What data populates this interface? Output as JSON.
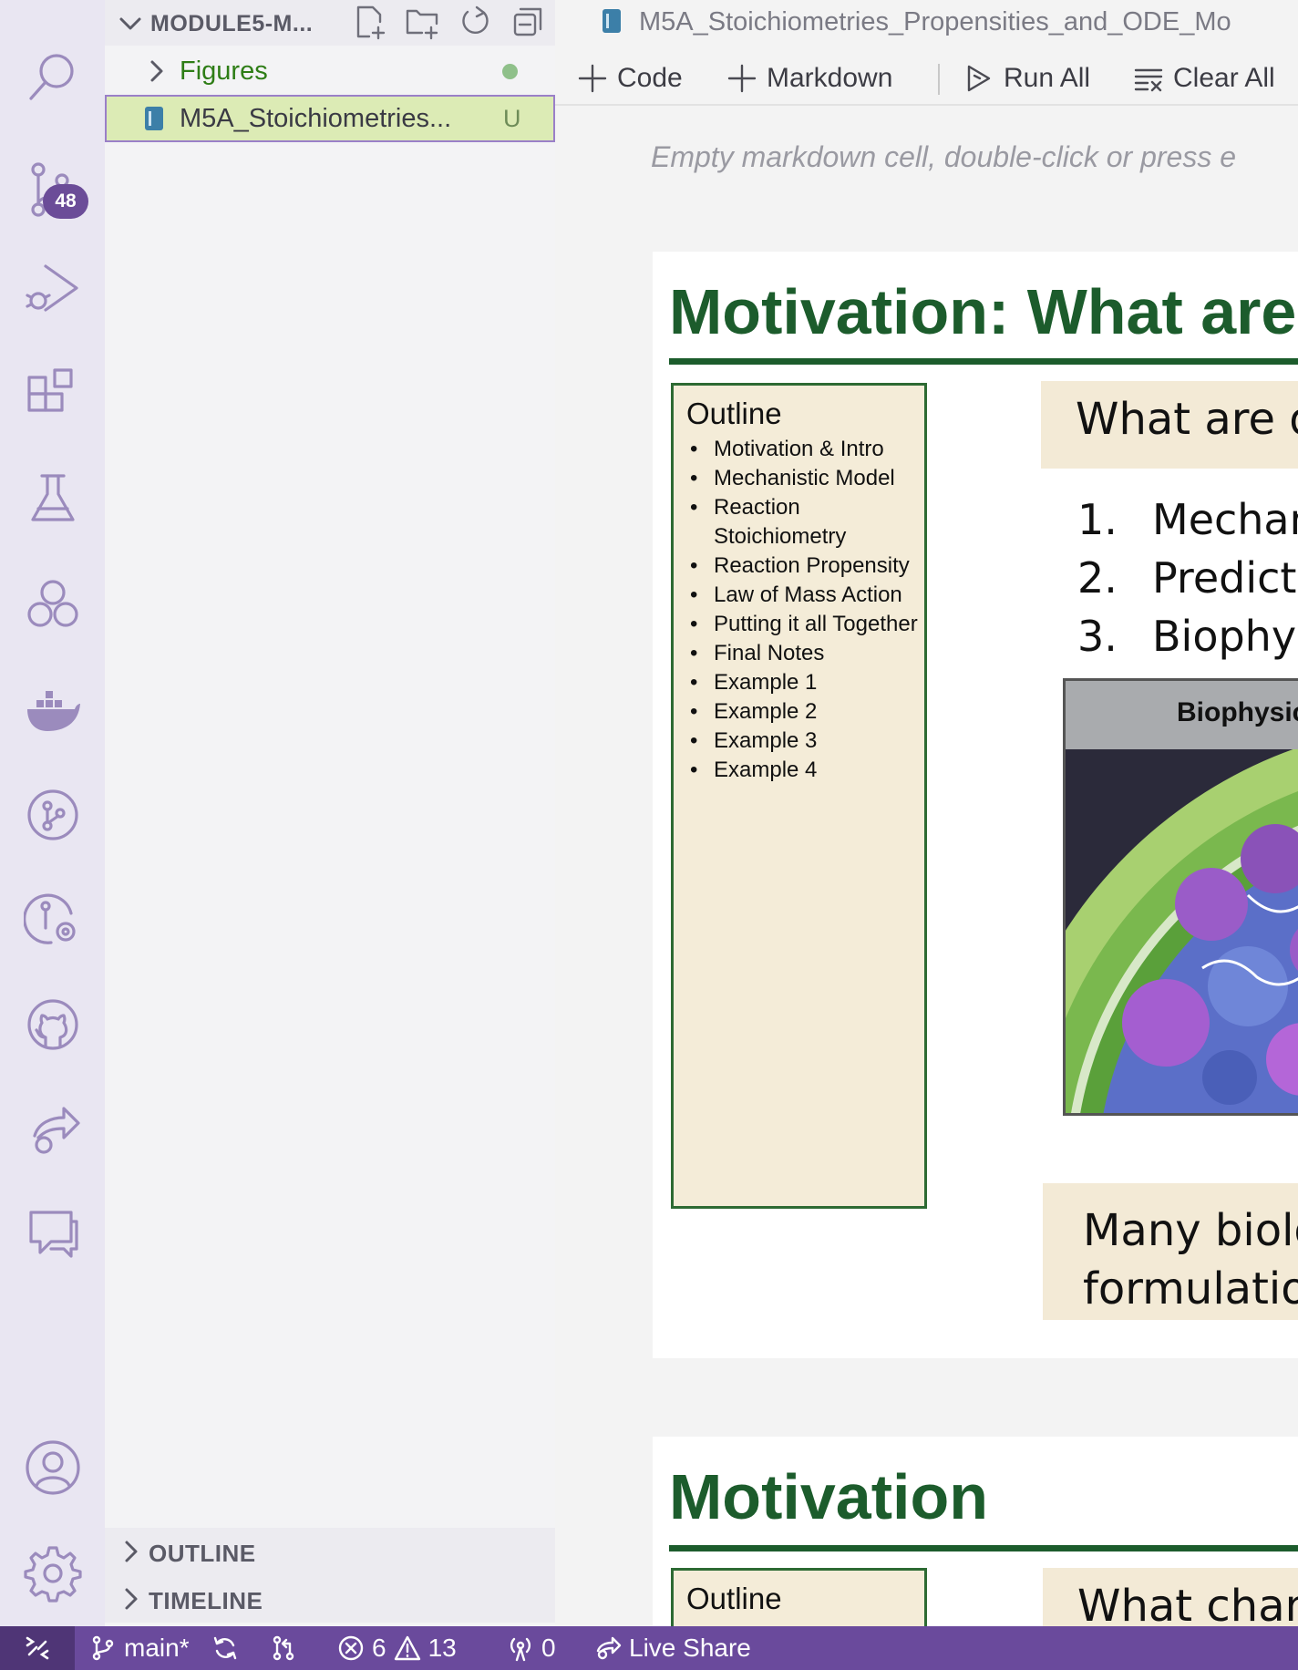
{
  "explorer": {
    "title": "MODULE5-M...",
    "items": [
      {
        "label": "Figures"
      },
      {
        "label": "M5A_Stoichiometries...",
        "status": "U"
      }
    ],
    "sections": [
      {
        "label": "OUTLINE"
      },
      {
        "label": "TIMELINE"
      }
    ]
  },
  "activity_bar": {
    "scm_badge": "48",
    "icons": [
      "search-icon",
      "source-control-icon",
      "run-debug-icon",
      "extensions-icon",
      "testing-icon",
      "remote-explorer-icon",
      "docker-icon",
      "git-graph-icon",
      "gitlens-icon",
      "github-icon",
      "live-share-icon",
      "comments-icon",
      "account-icon",
      "settings-gear-icon"
    ]
  },
  "editor": {
    "tab_title": "M5A_Stoichiometries_Propensities_and_ODE_Mo",
    "toolbar": {
      "code_label": "Code",
      "markdown_label": "Markdown",
      "run_all_label": "Run All",
      "clear_all_label": "Clear All"
    },
    "empty_markdown_placeholder": "Empty markdown cell, double-click or press e"
  },
  "slide1": {
    "title": "Motivation: What are",
    "outline_title": "Outline",
    "outline_items": [
      "Motivation & Intro",
      "Mechanistic Model",
      "Reaction Stoichiometry",
      "Reaction Propensity",
      "Law of Mass Action",
      "Putting it all Together",
      "Final Notes",
      "Example 1",
      "Example 2",
      "Example 3",
      "Example 4"
    ],
    "question": "What are dynam",
    "numbered": [
      {
        "n": "1.",
        "text": "Mechanistic"
      },
      {
        "n": "2.",
        "text": "Predictive po"
      },
      {
        "n": "3.",
        "text": "Biophysical b"
      }
    ],
    "figure_header": "Biophysical  Sys",
    "bottom_line1": "Many biological",
    "bottom_line2": "formulations of"
  },
  "slide2": {
    "title": "Motivation",
    "outline_title": "Outline",
    "question": "What changes in"
  },
  "statusbar": {
    "branch": "main*",
    "errors": "6",
    "warnings": "13",
    "ports": "0",
    "live_share": "Live Share"
  },
  "colors": {
    "activity_bar": "#e9e6f2",
    "status_bar": "#6a4a9c",
    "slide_title_green": "#1c5c2c",
    "outline_bg": "#f4ecd8"
  }
}
